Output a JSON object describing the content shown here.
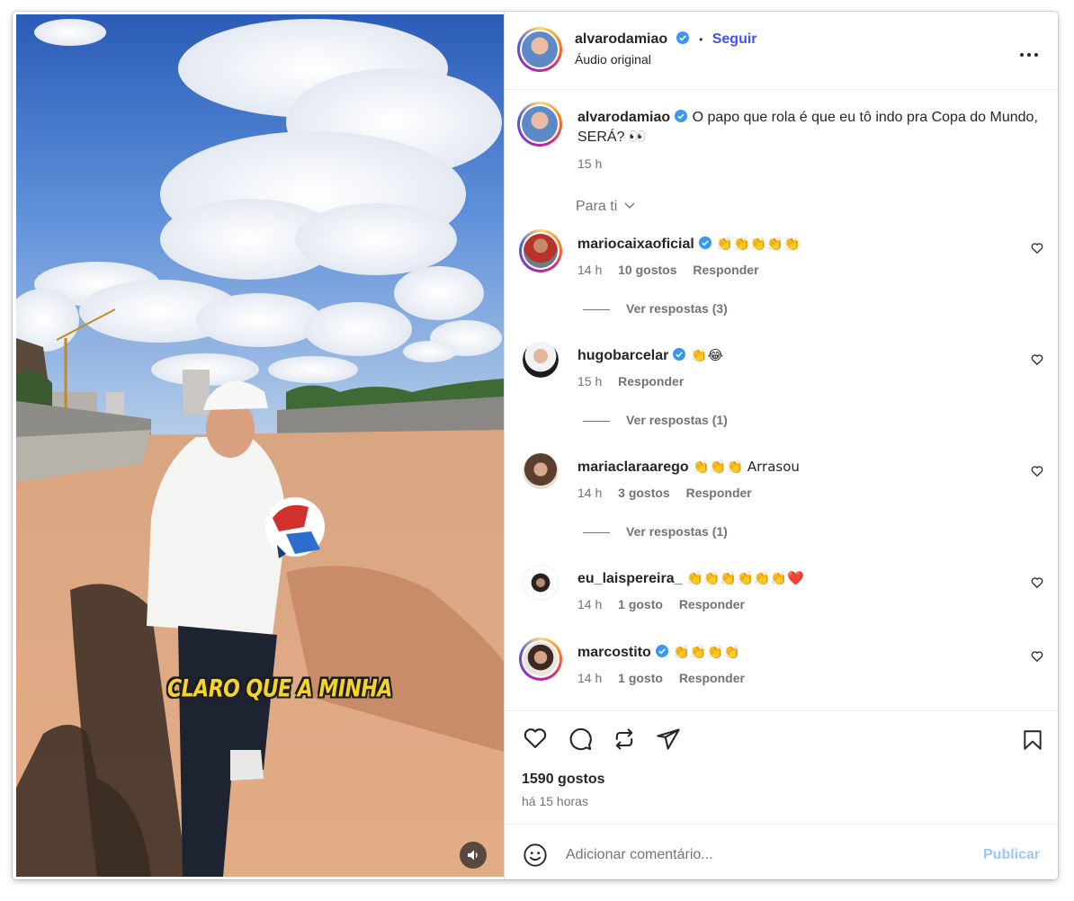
{
  "media": {
    "caption": "CLARO QUE A MINHA",
    "mute_icon": "volume-icon"
  },
  "header": {
    "username": "alvarodamiao",
    "follow_label": "Seguir",
    "separator": "•",
    "subtitle": "Áudio original",
    "more_label": "..."
  },
  "post": {
    "username": "alvarodamiao",
    "caption": "O papo que rola é que eu tô indo pra Copa do Mundo, SERÁ? 👀",
    "time": "15 h"
  },
  "sort_label": "Para ti",
  "comments": [
    {
      "username": "mariocaixaoficial",
      "verified": true,
      "text": "👏👏👏👏👏",
      "time": "14 h",
      "likes": "10 gostos",
      "reply": "Responder",
      "view_replies": "Ver respostas (3)"
    },
    {
      "username": "hugobarcelar",
      "verified": true,
      "text": "👏😂",
      "time": "15 h",
      "likes": "",
      "reply": "Responder",
      "view_replies": "Ver respostas (1)"
    },
    {
      "username": "mariaclaraarego",
      "verified": false,
      "text": "👏👏👏 Arrasou",
      "time": "14 h",
      "likes": "3 gostos",
      "reply": "Responder",
      "view_replies": "Ver respostas (1)"
    },
    {
      "username": "eu_laispereira_",
      "verified": false,
      "text": "👏👏👏👏👏👏❤️",
      "time": "14 h",
      "likes": "1 gosto",
      "reply": "Responder",
      "view_replies": ""
    },
    {
      "username": "marcostito",
      "verified": true,
      "text": "👏👏👏👏",
      "time": "14 h",
      "likes": "1 gosto",
      "reply": "Responder",
      "view_replies": ""
    }
  ],
  "footer": {
    "likes": "1590 gostos",
    "time_ago": "há 15 horas",
    "add_comment_placeholder": "Adicionar comentário...",
    "publish_label": "Publicar"
  },
  "colors": {
    "link_blue": "#4150f7",
    "verified_blue": "#3897f0",
    "publish_disabled": "#9fc7f5",
    "muted": "#737373"
  }
}
